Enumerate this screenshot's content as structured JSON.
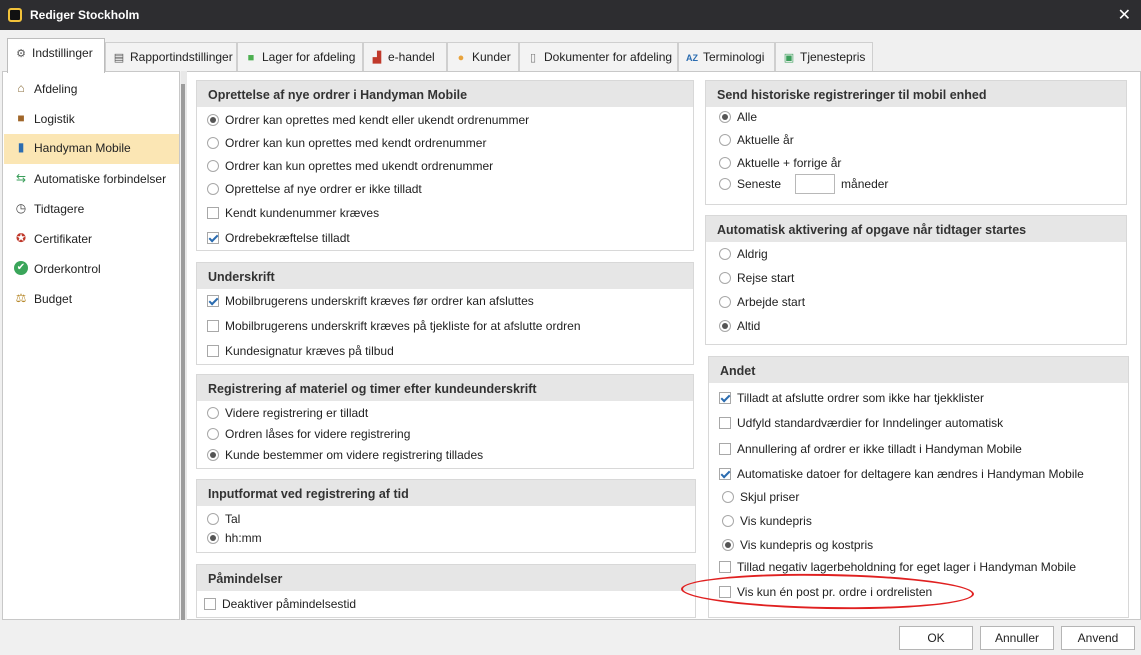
{
  "window": {
    "title": "Rediger Stockholm",
    "close_glyph": "✕"
  },
  "tabs": [
    {
      "label": "Indstillinger",
      "icon": "gear-icon"
    },
    {
      "label": "Rapportindstillinger",
      "icon": "printer-icon"
    },
    {
      "label": "Lager for afdeling",
      "icon": "truck-icon"
    },
    {
      "label": "e-handel",
      "icon": "factory-icon"
    },
    {
      "label": "Kunder",
      "icon": "user-icon"
    },
    {
      "label": "Dokumenter for afdeling",
      "icon": "document-icon"
    },
    {
      "label": "Terminologi",
      "icon": "az-icon"
    },
    {
      "label": "Tjenestepris",
      "icon": "price-icon"
    }
  ],
  "sidebar": {
    "items": [
      {
        "label": "Afdeling",
        "icon": "house-icon"
      },
      {
        "label": "Logistik",
        "icon": "box-icon"
      },
      {
        "label": "Handyman Mobile",
        "icon": "mobile-icon"
      },
      {
        "label": "Automatiske forbindelser",
        "icon": "arrows-icon"
      },
      {
        "label": "Tidtagere",
        "icon": "stopwatch-icon"
      },
      {
        "label": "Certifikater",
        "icon": "certificate-icon"
      },
      {
        "label": "Orderkontrol",
        "icon": "checkmark-icon"
      },
      {
        "label": "Budget",
        "icon": "scale-icon"
      }
    ]
  },
  "groups": {
    "oprettelse": {
      "title": "Oprettelse af nye ordrer i Handyman Mobile",
      "options": [
        {
          "type": "radio",
          "checked": true,
          "label": "Ordrer kan oprettes med kendt eller ukendt ordrenummer"
        },
        {
          "type": "radio",
          "checked": false,
          "label": "Ordrer kan kun oprettes med kendt ordrenummer"
        },
        {
          "type": "radio",
          "checked": false,
          "label": "Ordrer kan kun oprettes med ukendt ordrenummer"
        },
        {
          "type": "radio",
          "checked": false,
          "label": "Oprettelse af nye ordrer er ikke tilladt"
        },
        {
          "type": "check",
          "checked": false,
          "label": "Kendt kundenummer kræves"
        },
        {
          "type": "check",
          "checked": true,
          "label": "Ordrebekræftelse tilladt"
        }
      ]
    },
    "underskrift": {
      "title": "Underskrift",
      "options": [
        {
          "type": "check",
          "checked": true,
          "label": "Mobilbrugerens underskrift kræves før ordrer kan afsluttes"
        },
        {
          "type": "check",
          "checked": false,
          "label": "Mobilbrugerens underskrift kræves på tjekliste for at afslutte ordren"
        },
        {
          "type": "check",
          "checked": false,
          "label": "Kundesignatur kræves på tilbud"
        }
      ]
    },
    "registrering": {
      "title": "Registrering af materiel og timer efter kundeunderskrift",
      "options": [
        {
          "type": "radio",
          "checked": false,
          "label": "Videre registrering er tilladt"
        },
        {
          "type": "radio",
          "checked": false,
          "label": "Ordren låses for videre registrering"
        },
        {
          "type": "radio",
          "checked": true,
          "label": "Kunde bestemmer om videre registrering tillades"
        }
      ]
    },
    "inputformat": {
      "title": "Inputformat ved registrering af tid",
      "options": [
        {
          "type": "radio",
          "checked": false,
          "label": "Tal"
        },
        {
          "type": "radio",
          "checked": true,
          "label": "hh:mm"
        }
      ]
    },
    "pamindelser": {
      "title": "Påmindelser",
      "options": [
        {
          "type": "check",
          "checked": false,
          "label": "Deaktiver påmindelsestid"
        }
      ]
    },
    "historik": {
      "title": "Send historiske registreringer til mobil enhed",
      "options": [
        {
          "type": "radio",
          "checked": true,
          "label": "Alle"
        },
        {
          "type": "radio",
          "checked": false,
          "label": "Aktuelle år"
        },
        {
          "type": "radio",
          "checked": false,
          "label": "Aktuelle + forrige år"
        },
        {
          "type": "radio",
          "checked": false,
          "label": "Seneste"
        }
      ],
      "months_value": "",
      "months_suffix": "måneder"
    },
    "aktivering": {
      "title": "Automatisk aktivering af opgave når tidtager startes",
      "options": [
        {
          "type": "radio",
          "checked": false,
          "label": "Aldrig"
        },
        {
          "type": "radio",
          "checked": false,
          "label": "Rejse start"
        },
        {
          "type": "radio",
          "checked": false,
          "label": "Arbejde start"
        },
        {
          "type": "radio",
          "checked": true,
          "label": "Altid"
        }
      ]
    },
    "andet": {
      "title": "Andet",
      "options": [
        {
          "type": "check",
          "checked": true,
          "label": "Tilladt at afslutte ordrer som ikke har tjekklister"
        },
        {
          "type": "check",
          "checked": false,
          "label": "Udfyld standardværdier for Inndelinger automatisk"
        },
        {
          "type": "check",
          "checked": false,
          "label": "Annullering af ordrer er ikke tilladt i Handyman Mobile"
        },
        {
          "type": "check",
          "checked": true,
          "label": "Automatiske datoer for deltagere kan ændres i Handyman Mobile"
        },
        {
          "type": "radio",
          "checked": false,
          "label": "Skjul priser"
        },
        {
          "type": "radio",
          "checked": false,
          "label": "Vis kundepris"
        },
        {
          "type": "radio",
          "checked": true,
          "label": "Vis kundepris og kostpris"
        },
        {
          "type": "check",
          "checked": false,
          "label": "Tillad negativ lagerbeholdning for eget lager i Handyman Mobile"
        },
        {
          "type": "check",
          "checked": false,
          "label": "Vis kun én post pr. ordre i ordrelisten"
        }
      ]
    }
  },
  "footer": {
    "ok": "OK",
    "cancel": "Annuller",
    "apply": "Anvend"
  },
  "colors": {
    "titlebar": "#2d2d30",
    "active_sidebar": "#fbe6b4",
    "annotation": "#e02020"
  }
}
